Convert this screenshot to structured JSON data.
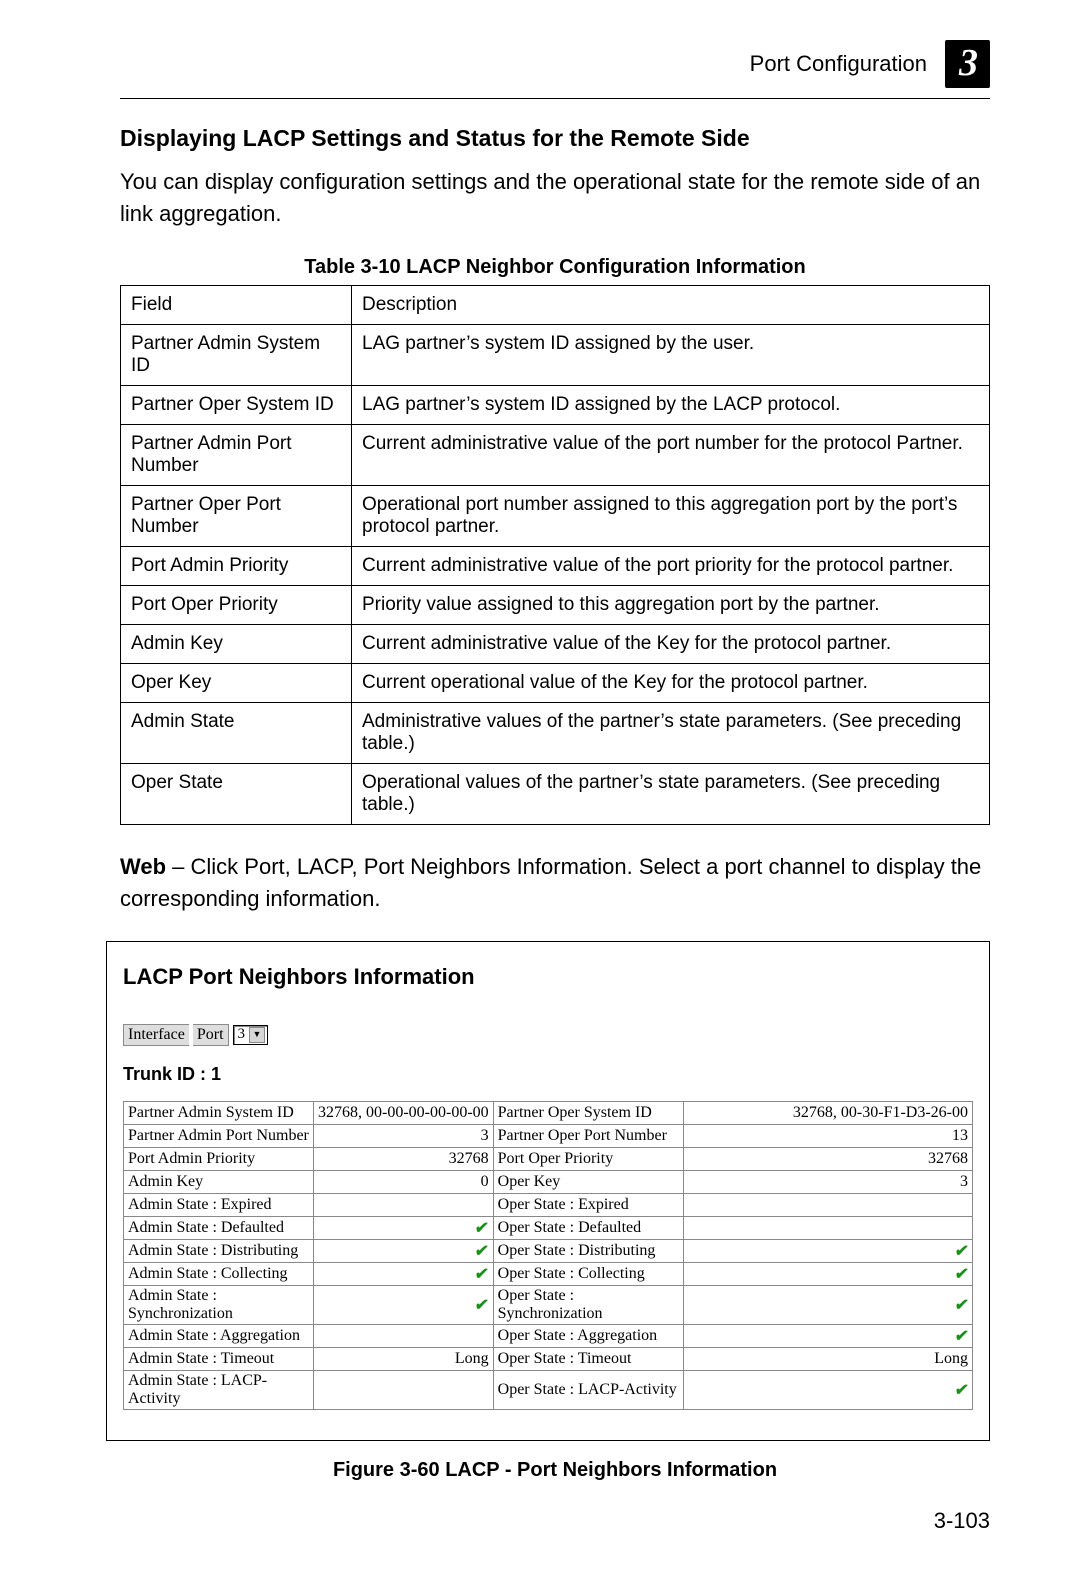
{
  "header": {
    "crumb": "Port Configuration",
    "chapter": "3"
  },
  "heading": "Displaying LACP Settings and Status for the Remote Side",
  "intro": "You can display configuration settings and the operational state for the remote side of an link aggregation.",
  "table_caption": "Table 3-10  LACP Neighbor Configuration Information",
  "col_field": "Field",
  "col_desc": "Description",
  "rows": [
    {
      "f": "Partner Admin System ID",
      "d": "LAG partner’s system ID assigned by the user."
    },
    {
      "f": "Partner Oper System ID",
      "d": "LAG partner’s system ID assigned by the LACP protocol."
    },
    {
      "f": "Partner Admin Port Number",
      "d": "Current administrative value of the port number for the protocol Partner."
    },
    {
      "f": "Partner Oper Port Number",
      "d": "Operational port number assigned to this aggregation port by the port’s protocol partner."
    },
    {
      "f": "Port Admin Priority",
      "d": "Current administrative value of the port priority for the protocol partner."
    },
    {
      "f": "Port Oper Priority",
      "d": "Priority value assigned to this aggregation port by the partner."
    },
    {
      "f": "Admin Key",
      "d": "Current administrative value of the Key for the protocol partner."
    },
    {
      "f": "Oper Key",
      "d": "Current operational value of the Key for the protocol partner."
    },
    {
      "f": "Admin State",
      "d": "Administrative values of the partner’s state parameters. (See preceding table.)"
    },
    {
      "f": "Oper State",
      "d": "Operational values of the partner’s state parameters. (See preceding table.)"
    }
  ],
  "web_label": "Web",
  "web_text": " – Click Port, LACP, Port Neighbors Information. Select a port channel to display the corresponding information.",
  "panel": {
    "title": "LACP Port Neighbors Information",
    "iface_label": "Interface",
    "iface_port": "Port",
    "iface_value": "3",
    "trunk": "Trunk ID : 1",
    "rows": [
      {
        "l": "Partner Admin System ID",
        "lv": "32768, 00-00-00-00-00-00",
        "lvt": "text",
        "r": "Partner Oper System ID",
        "rv": "32768, 00-30-F1-D3-26-00",
        "rvt": "text"
      },
      {
        "l": "Partner Admin Port Number",
        "lv": "3",
        "lvt": "num",
        "r": "Partner Oper Port Number",
        "rv": "13",
        "rvt": "num"
      },
      {
        "l": "Port Admin Priority",
        "lv": "32768",
        "lvt": "num",
        "r": "Port Oper Priority",
        "rv": "32768",
        "rvt": "num"
      },
      {
        "l": "Admin Key",
        "lv": "0",
        "lvt": "num",
        "r": "Oper Key",
        "rv": "3",
        "rvt": "num"
      },
      {
        "l": "Admin State : Expired",
        "lv": "",
        "lvt": "",
        "r": "Oper State : Expired",
        "rv": "",
        "rvt": ""
      },
      {
        "l": "Admin State : Defaulted",
        "lv": "",
        "lvt": "check",
        "r": "Oper State : Defaulted",
        "rv": "",
        "rvt": ""
      },
      {
        "l": "Admin State : Distributing",
        "lv": "",
        "lvt": "check",
        "r": "Oper State : Distributing",
        "rv": "",
        "rvt": "check"
      },
      {
        "l": "Admin State : Collecting",
        "lv": "",
        "lvt": "check",
        "r": "Oper State : Collecting",
        "rv": "",
        "rvt": "check"
      },
      {
        "l": "Admin State : Synchronization",
        "lv": "",
        "lvt": "check",
        "r": "Oper State : Synchronization",
        "rv": "",
        "rvt": "check"
      },
      {
        "l": "Admin State : Aggregation",
        "lv": "",
        "lvt": "",
        "r": "Oper State : Aggregation",
        "rv": "",
        "rvt": "check"
      },
      {
        "l": "Admin State : Timeout",
        "lv": "Long",
        "lvt": "text",
        "r": "Oper State : Timeout",
        "rv": "Long",
        "rvt": "text"
      },
      {
        "l": "Admin State : LACP-Activity",
        "lv": "",
        "lvt": "",
        "r": "Oper State : LACP-Activity",
        "rv": "",
        "rvt": "check"
      }
    ]
  },
  "figure_caption": "Figure 3-60  LACP - Port Neighbors Information",
  "page_number": "3-103"
}
